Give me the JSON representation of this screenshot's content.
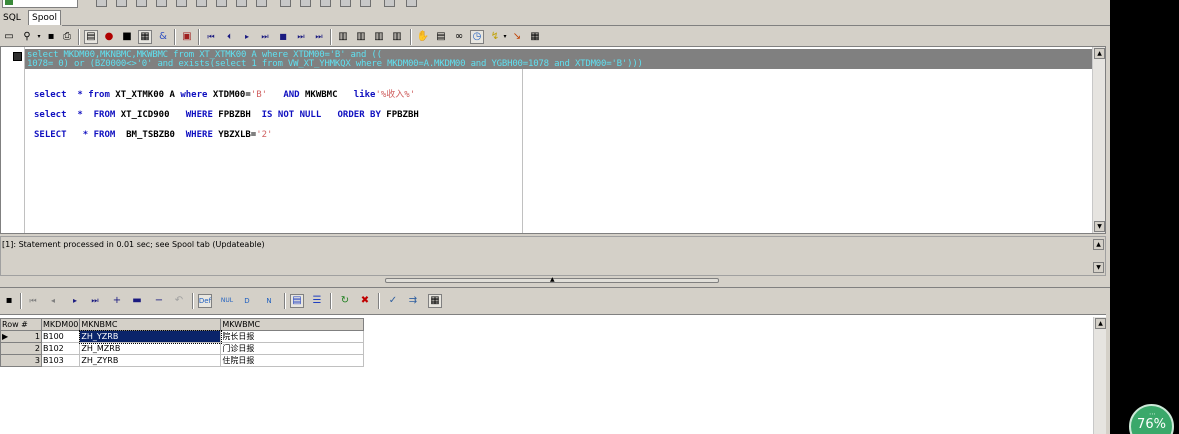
{
  "tabs": [
    {
      "label": "SQL"
    },
    {
      "label": "Spool"
    }
  ],
  "editor": {
    "selected_lines": [
      "select MKDM00,MKNBMC,MKWBMC from XT_XTMK00 A where XTDM00='B' and ((",
      "1078= 0) or (BZ0000<>'0' and exists(select 1 from VW_XT_YHMKQX where MKDM00=A.MKDM00 and YGBH00=1078 and XTDM00='B')))"
    ],
    "line1": {
      "kw1": "select",
      "star": "* from",
      "obj": "XT_XTMK00 A",
      "kw2": "where",
      "cond": "XTDM00=",
      "s1": "'B'",
      "kw3": "AND",
      "col": "MKWBMC",
      "kw4": "like",
      "s2": "'%收入%'"
    },
    "line2": {
      "kw1": "select",
      "star": "*  FROM",
      "obj": "XT_ICD900",
      "kw2": "WHERE",
      "col": "FPBZBH",
      "kw3": "IS NOT NULL",
      "kw4": "ORDER BY",
      "col2": "FPBZBH"
    },
    "line3": {
      "kw1": "SELECT",
      "star": "* FROM",
      "obj": "BM_TSBZB0",
      "kw2": "WHERE",
      "cond": "YBZXLB=",
      "s1": "'2'"
    }
  },
  "status": {
    "message": "[1]: Statement processed in 0.01 sec; see Spool tab (Updateable)"
  },
  "grid": {
    "columns": [
      "Row #",
      "MKDM00",
      "MKNBMC",
      "MKWBMC"
    ],
    "rows": [
      {
        "row": "1",
        "MKDM00": "B100",
        "MKNBMC": "ZH_YZRB",
        "MKWBMC": "院长日报"
      },
      {
        "row": "2",
        "MKDM00": "B102",
        "MKNBMC": "ZH_MZRB",
        "MKWBMC": "门诊日报"
      },
      {
        "row": "3",
        "MKDM00": "B103",
        "MKNBMC": "ZH_ZYRB",
        "MKWBMC": "住院日报"
      }
    ]
  },
  "zoom": {
    "label": "76%"
  },
  "icons": [
    "new-icon",
    "find-icon",
    "save-icon",
    "print-icon",
    "explain-icon",
    "run-icon",
    "stop-icon",
    "first-icon",
    "prev-icon",
    "next-icon",
    "last-icon",
    "commit-icon",
    "rollback-icon",
    "binoculars-icon",
    "clock-icon",
    "brush-icon",
    "table-icon",
    "grid-save-icon",
    "add-row-icon",
    "delete-row-icon",
    "refresh-icon",
    "cancel-icon",
    "spellcheck-icon"
  ]
}
